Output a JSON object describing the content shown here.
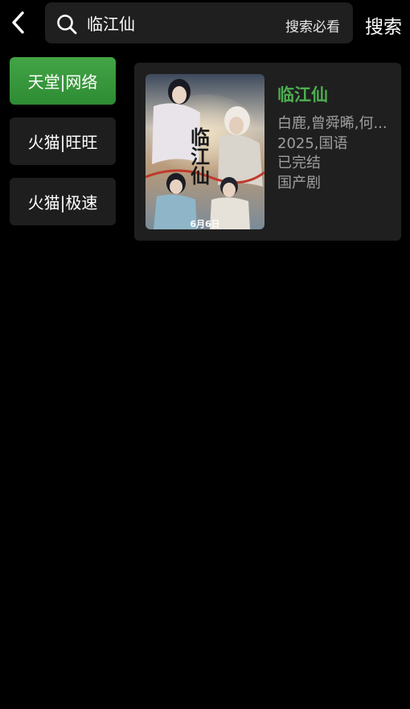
{
  "header": {
    "search_value": "临江仙",
    "search_hint": "搜索必看",
    "search_button": "搜索"
  },
  "sources": [
    {
      "label": "天堂|网络",
      "active": true
    },
    {
      "label": "火猫|旺旺",
      "active": false
    },
    {
      "label": "火猫|极速",
      "active": false
    }
  ],
  "result": {
    "title": "临江仙",
    "actors": "白鹿,曾舜晞,何...",
    "year_lang": "2025,国语",
    "status": "已完结",
    "genre": "国产剧",
    "poster_title_art": "临江仙",
    "poster_date": "6月6日"
  },
  "colors": {
    "accent": "#4caf50",
    "active_source": "#3a9b3e",
    "panel": "#1f1f1f",
    "background": "#000000"
  }
}
